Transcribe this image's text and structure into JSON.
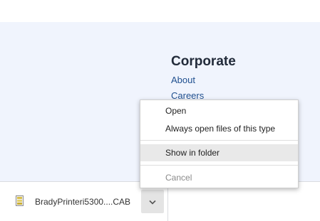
{
  "page": {
    "footer": {
      "heading": "Corporate",
      "links": [
        "About",
        "Careers"
      ]
    }
  },
  "download_shelf": {
    "file_name": "BradyPrinteri5300....CAB",
    "file_icon": "cab-archive-icon",
    "chevron_icon": "chevron-down-icon"
  },
  "context_menu": {
    "items": [
      {
        "label": "Open",
        "state": "normal"
      },
      {
        "label": "Always open files of this type",
        "state": "normal"
      },
      {
        "label": "Show in folder",
        "state": "hovered"
      },
      {
        "label": "Cancel",
        "state": "disabled"
      }
    ]
  },
  "colors": {
    "footer_background": "#f0f4fd",
    "link": "#1f4f8f",
    "menu_hover": "#e9e9e9",
    "disabled_text": "#8a8a8a"
  }
}
